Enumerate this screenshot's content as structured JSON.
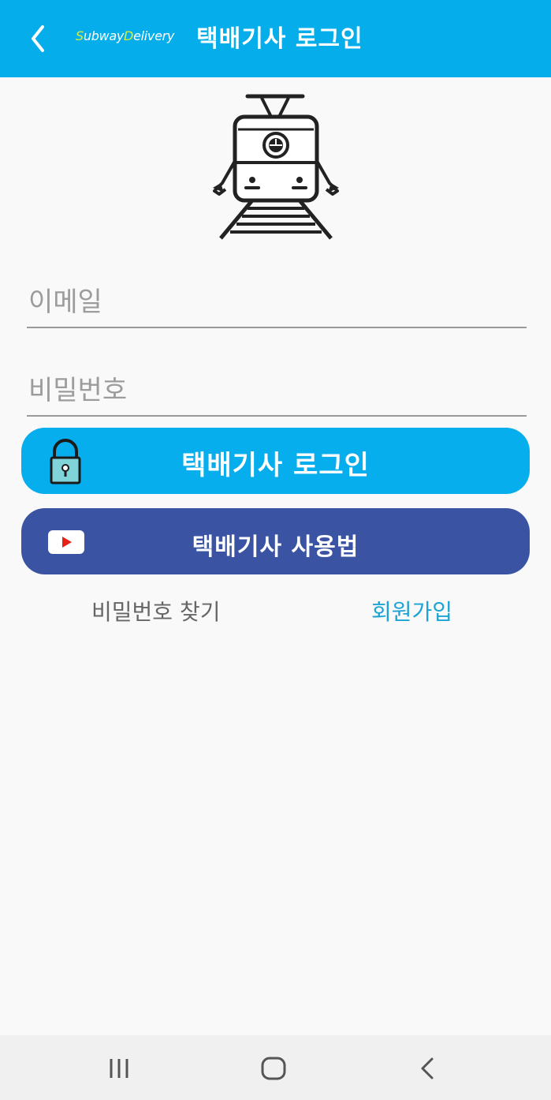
{
  "header": {
    "back_icon": "chevron-left-icon",
    "logo": {
      "first_letter": "S",
      "first_rest": "ubway",
      "second_letter": "D",
      "second_rest": "elivery"
    },
    "title": "택배기사 로그인"
  },
  "hero_icon": "subway-train-icon",
  "form": {
    "email_placeholder": "이메일",
    "password_placeholder": "비밀번호"
  },
  "buttons": {
    "login_label": "택배기사 로그인",
    "login_icon": "lock-icon",
    "guide_label": "택배기사 사용법",
    "guide_icon": "youtube-play-icon"
  },
  "links": {
    "find_password": "비밀번호 찾기",
    "signup": "회원가입"
  },
  "navbar": {
    "recents_icon": "recent-apps-icon",
    "home_icon": "home-icon",
    "back_icon": "nav-back-icon"
  },
  "colors": {
    "header_bg": "#05aeea",
    "login_button": "#06aeee",
    "guide_button": "#3a54a3",
    "signup_link": "#1ba3d3",
    "logo_accent": "#d8ee3a"
  }
}
